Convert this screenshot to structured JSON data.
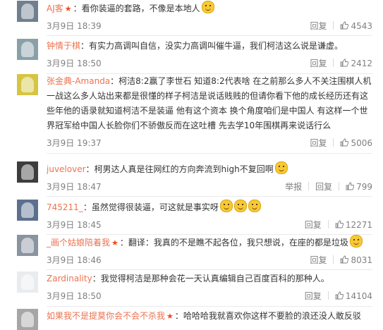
{
  "action_labels": {
    "reply": "回复",
    "report": "举报"
  },
  "colors": {
    "username": "#eb7350",
    "text": "#333333",
    "meta": "#808080",
    "vip_badge": "#f2471d"
  },
  "icons": {
    "like": "thumb-up-icon",
    "vip": "star-icon",
    "emoji": "emoji-icon"
  },
  "comments": [
    {
      "user": "AJ客",
      "vip": true,
      "text": "：看你装逼的套路，不像是本地人",
      "emojis": 1,
      "time": "3月9日 18:39",
      "likes": "4543",
      "report": false
    },
    {
      "user": "钟情于棋",
      "vip": false,
      "text": "：有实力高调叫自信，没实力高调叫催牛逼，我们柯洁这么说是谦虚。",
      "emojis": 0,
      "time": "3月9日 18:50",
      "likes": "2412",
      "report": false
    },
    {
      "user": "张金典-Amanda",
      "vip": false,
      "text": "：柯洁8:2赢了李世石 知道8:2代表啥 在之前那么多人不关注围棋人机一战这么多人站出来都是很懂的样子柯洁是说话贱贱的但请你看下他的成长经历还有这些年他的语录就知道柯洁不是装逼 他有这个资本 换个角度咱们是中国人 有这样一个世界冠军给中国人长脸你们不骄傲反而在这吐槽 先去学10年围棋再来说话行么",
      "emojis": 0,
      "time": "3月9日 19:37",
      "likes": "5006",
      "report": false
    },
    {
      "user": "juvelover",
      "vip": false,
      "text": "：柯男达人真是往网红的方向奔流到high不复回啊",
      "emojis": 1,
      "time": "3月9日 18:47",
      "likes": "799",
      "report": true
    },
    {
      "user": "745211_",
      "vip": false,
      "text": "：虽然觉得很装逼，可这就是事实呀",
      "emojis": 3,
      "time": "3月9日 18:45",
      "likes": "12271",
      "report": false
    },
    {
      "user": "_画个姑娘陪着我",
      "vip": true,
      "text": "：翻译：我真的不是瞧不起各位，我只想说，在座的都是垃圾",
      "emojis": 1,
      "time": "3月9日 18:46",
      "likes": "8031",
      "report": false
    },
    {
      "user": "Zardinality",
      "vip": false,
      "text": "：我觉得柯洁是那种会花一天认真编辑自己百度百科的那种人。",
      "emojis": 0,
      "time": "3月9日 18:50",
      "likes": "14104",
      "report": false
    },
    {
      "user": "如果我不是提莫你会不会不杀我",
      "vip": true,
      "text": "：哈哈哈我就喜欢你这样不要脸的浪还没人敢反驳",
      "emojis": 0,
      "time": "",
      "likes": "",
      "report": false
    }
  ]
}
